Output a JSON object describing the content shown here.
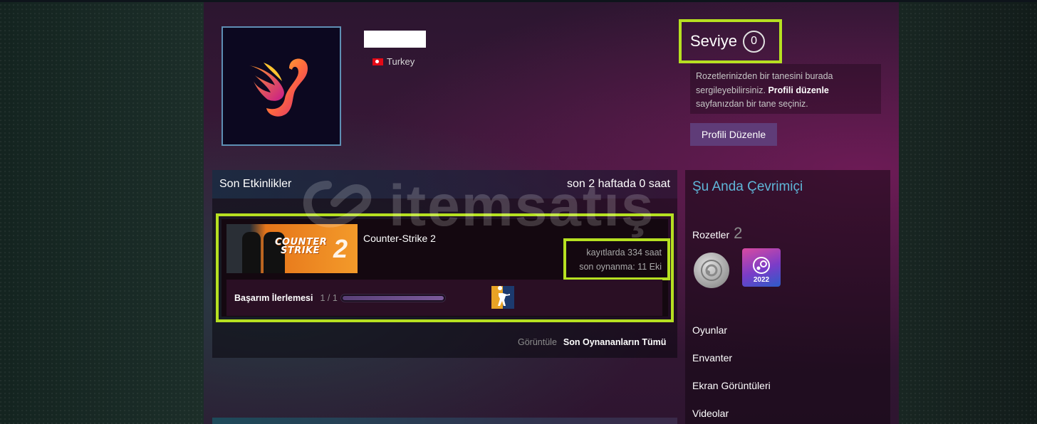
{
  "profile": {
    "country": "Turkey",
    "level_label": "Seviye",
    "level_value": "0",
    "badge_hint_pre": "Rozetlerinizden bir tanesini burada sergileyebilirsiniz.",
    "badge_hint_link": "Profili düzenle",
    "badge_hint_post": "sayfanızdan bir tane seçiniz.",
    "edit_button": "Profili Düzenle"
  },
  "activity": {
    "title": "Son Etkinlikler",
    "summary": "son 2 haftada 0 saat",
    "game": {
      "name": "Counter-Strike 2",
      "capsule_text_1": "COUNTER",
      "capsule_text_2": "STRIKE",
      "capsule_number": "2",
      "hours_on_record": "kayıtlarda 334 saat",
      "last_played": "son oynanma: 11 Eki",
      "achievement_label": "Başarım İlerlemesi",
      "achievement_count": "1 / 1",
      "achievement_progress": 1.0
    },
    "view_label": "Görüntüle",
    "view_all_link": "Son Oynananların Tümü"
  },
  "sidebar": {
    "online_status": "Şu Anda Çevrimiçi",
    "badges_label": "Rozetler",
    "badges_count": "2",
    "badge2_year": "2022",
    "links": [
      "Oyunlar",
      "Envanter",
      "Ekran Görüntüleri",
      "Videolar"
    ]
  },
  "watermark": {
    "text": "itemsatış"
  },
  "colors": {
    "highlight": "#b6e021",
    "online": "#5fb6d8",
    "edit_button": "#5f3c78"
  }
}
